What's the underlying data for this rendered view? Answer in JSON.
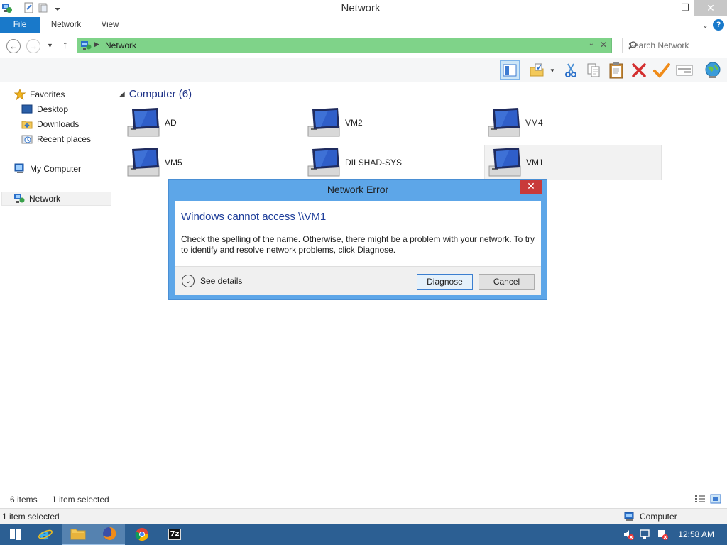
{
  "window": {
    "title": "Network"
  },
  "ribbon": {
    "tabs": [
      "File",
      "Network",
      "View"
    ]
  },
  "address": {
    "path": "Network",
    "search_placeholder": "Search Network"
  },
  "nav": {
    "favorites": "Favorites",
    "favorites_items": [
      "Desktop",
      "Downloads",
      "Recent places"
    ],
    "my_computer": "My Computer",
    "network": "Network"
  },
  "content": {
    "group_label": "Computer (6)",
    "computers": [
      "AD",
      "VM2",
      "VM4",
      "VM5",
      "DILSHAD-SYS",
      "VM1"
    ]
  },
  "status": {
    "items": "6 items",
    "selected": "1 item selected",
    "bottom_left": "1 item selected",
    "bottom_right": "Computer"
  },
  "dialog": {
    "title": "Network Error",
    "close": "✕",
    "heading": "Windows cannot access \\\\VM1",
    "message": "Check the spelling of the name. Otherwise, there might be a problem with your network. To try to identify and resolve network problems, click Diagnose.",
    "see_details": "See details",
    "diagnose": "Diagnose",
    "cancel": "Cancel"
  },
  "taskbar": {
    "clock": "12:58 AM",
    "sevenzip": "7z"
  },
  "colors": {
    "accent": "#1979ca",
    "address_bg": "#7fd389",
    "dialog_frame": "#5da6e8",
    "taskbar": "#2c5f93"
  }
}
